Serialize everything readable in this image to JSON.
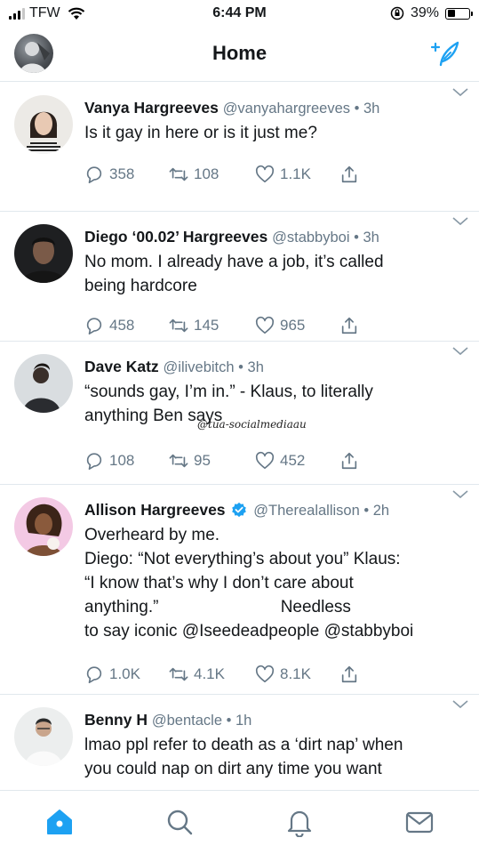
{
  "status_bar": {
    "carrier": "TFW",
    "time": "6:44 PM",
    "battery": "39%",
    "battery_level": 0.39
  },
  "header": {
    "title": "Home",
    "avatar_icon": "profile-avatar",
    "compose_icon": "compose-tweet-icon"
  },
  "colors": {
    "accent": "#1da1f2",
    "text": "#14171a",
    "muted": "#657786",
    "divider": "#e1e8ed"
  },
  "tweets": [
    {
      "name": "Vanya Hargreeves",
      "handle": "@vanyahargreeves",
      "time": "3h",
      "lines": [
        "Is it gay in here or is it just me?"
      ],
      "replies": "358",
      "retweets": "108",
      "likes": "1.1K"
    },
    {
      "name": "Diego ‘00.02’ Hargreeves",
      "handle": "@stabbyboi",
      "time": "3h",
      "lines": [
        "No mom. I already have a job, it’s called",
        "being hardcore"
      ],
      "replies": "458",
      "retweets": "145",
      "likes": "965"
    },
    {
      "name": "Dave Katz",
      "handle": "@ilivebitch",
      "time": "3h",
      "lines": [
        "“sounds gay, I’m in.” - Klaus, to literally",
        "anything Ben says"
      ],
      "replies": "108",
      "retweets": "95",
      "likes": "452"
    },
    {
      "name": "Allison Hargreeves",
      "handle": "@Therealallison",
      "time": "2h",
      "verified": true,
      "lines": [
        "Overheard by me.",
        "Diego: “Not everything’s about you” Klaus:",
        "“I know that’s why I don’t care about",
        "anything.”                          Needless",
        "to say iconic @Iseedeadpeople @stabbyboi"
      ],
      "replies": "1.0K",
      "retweets": "4.1K",
      "likes": "8.1K"
    },
    {
      "name": "Benny H",
      "handle": "@bentacle",
      "time": "1h",
      "lines": [
        "lmao ppl refer to death as a ‘dirt nap’ when",
        "you could nap on dirt any time you want"
      ]
    }
  ],
  "watermark": "@tua-socialmediaau",
  "tab_bar": [
    "home-icon",
    "search-icon",
    "notifications-icon",
    "messages-icon"
  ]
}
